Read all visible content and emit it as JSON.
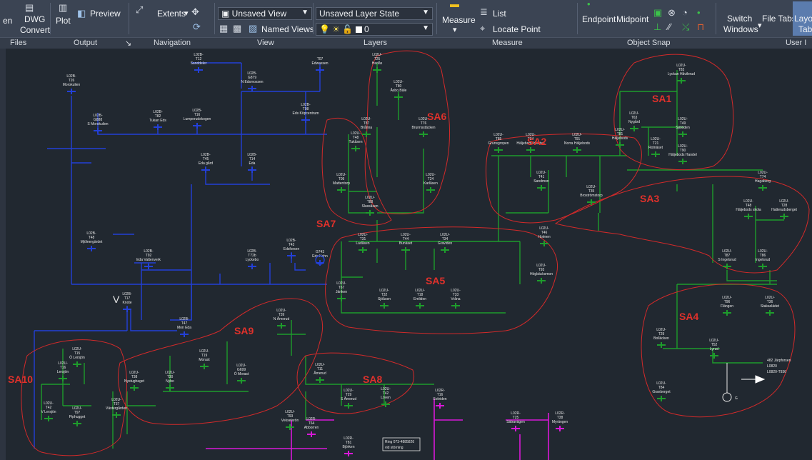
{
  "ribbon": {
    "buttons": {
      "open": "en",
      "dwg_convert_1": "DWG",
      "dwg_convert_2": "Convert",
      "plot": "Plot",
      "preview": "Preview",
      "extents": "Extents",
      "unsaved_view": "Unsaved View",
      "named_views": "Named Views",
      "layer_state": "Unsaved Layer State",
      "layer_current": "0",
      "measure": "Measure",
      "list": "List",
      "locate_point": "Locate Point",
      "endpoint": "Endpoint",
      "midpoint": "Midpoint",
      "switch_windows_1": "Switch",
      "switch_windows_2": "Windows",
      "file_tabs": "File Tabs",
      "layout_tabs_1": "Layo",
      "layout_tabs_2": "Tabs"
    },
    "groups": {
      "files": "Files",
      "output": "Output",
      "navigation": "Navigation",
      "view": "View",
      "layers": "Layers",
      "measure": "Measure",
      "object_snap": "Object Snap",
      "user_interface": "User I"
    }
  },
  "drawing": {
    "areas": [
      {
        "id": "SA1",
        "label": "SA1"
      },
      {
        "id": "SA2",
        "label": "SA2"
      },
      {
        "id": "SA3",
        "label": "SA3"
      },
      {
        "id": "SA4",
        "label": "SA4"
      },
      {
        "id": "SA5",
        "label": "SA5"
      },
      {
        "id": "SA6",
        "label": "SA6"
      },
      {
        "id": "SA7",
        "label": "SA7"
      },
      {
        "id": "SA8",
        "label": "SA8"
      },
      {
        "id": "SA9",
        "label": "SA9"
      },
      {
        "id": "SA10",
        "label": "SA10"
      }
    ],
    "nodes": [
      {
        "id": "n1",
        "l1": "L02B-",
        "l2": "T26",
        "l3": "Morokulien"
      },
      {
        "id": "n2",
        "l1": "L02B-",
        "l2": "T12",
        "l3": "Sanddeler"
      },
      {
        "id": "n3",
        "l1": "",
        "l2": "T07",
        "l3": "Edwassen"
      },
      {
        "id": "n4",
        "l1": "L02B-",
        "l2": "G879",
        "l3": "N Edsmossen"
      },
      {
        "id": "n5",
        "l1": "L02B-",
        "l2": "G888",
        "l3": "S Morokulien"
      },
      {
        "id": "n6",
        "l1": "L02B-",
        "l2": "T82",
        "l3": "Tukan Eds"
      },
      {
        "id": "n7",
        "l1": "L02B-",
        "l2": "T16",
        "l3": "Lumperudskogen"
      },
      {
        "id": "n8",
        "l1": "L02B-",
        "l2": "T98",
        "l3": "Eds Köpcentrum"
      },
      {
        "id": "n9",
        "l1": "L02B-",
        "l2": "T45",
        "l3": "Eda gård"
      },
      {
        "id": "n10",
        "l1": "L02B-",
        "l2": "T14",
        "l3": "Eda"
      },
      {
        "id": "n11",
        "l1": "L02B-",
        "l2": "T48",
        "l3": "Mjölnergärdet"
      },
      {
        "id": "n12",
        "l1": "L02B-",
        "l2": "T92",
        "l3": "Eda Vattenverk"
      },
      {
        "id": "n13",
        "l1": "L02B-",
        "l2": "T43",
        "l3": "Edsforsen"
      },
      {
        "id": "n14",
        "l1": "",
        "l2": "G743",
        "l3": "Eds Kehn"
      },
      {
        "id": "n15",
        "l1": "L02B-",
        "l2": "T72b",
        "l3": "Lyckebo"
      },
      {
        "id": "n16",
        "l1": "L02B-",
        "l2": "T17",
        "l3": "Knote"
      },
      {
        "id": "n17",
        "l1": "L02B-",
        "l2": "T47",
        "l3": "Mon Eda"
      },
      {
        "id": "n18",
        "l1": "L02U-",
        "l2": "T25",
        "l3": "Hedås"
      },
      {
        "id": "n19",
        "l1": "L02U-",
        "l2": "T80",
        "l3": "Åsbo Bäle"
      },
      {
        "id": "n20",
        "l1": "L02U-",
        "l2": "T87",
        "l3": "Brånna"
      },
      {
        "id": "n21",
        "l1": "L02U-",
        "l2": "T76",
        "l3": "Brunnsstäcken"
      },
      {
        "id": "n22",
        "l1": "L02U-",
        "l2": "T48",
        "l3": "Tukåsen"
      },
      {
        "id": "n23",
        "l1": "L02U-",
        "l2": "T09",
        "l3": "Mattentorp"
      },
      {
        "id": "n24",
        "l1": "L02U-",
        "l2": "T24",
        "l3": "Karlåsen"
      },
      {
        "id": "n25",
        "l1": "L02U-",
        "l2": "T88",
        "l3": "Slussåsen"
      },
      {
        "id": "n26",
        "l1": "L02U-",
        "l2": "T85",
        "l3": "Grunsgropen"
      },
      {
        "id": "n27",
        "l1": "L02U-",
        "l2": "T84",
        "l3": "Häljebods Klätten"
      },
      {
        "id": "n28",
        "l1": "L02U-",
        "l2": "T91",
        "l3": "Norra Häljebods"
      },
      {
        "id": "n29",
        "l1": "L02U-",
        "l2": "T81",
        "l3": "Häljebods"
      },
      {
        "id": "n30",
        "l1": "L02U-",
        "l2": "T83",
        "l3": "Lyckan Håvilerud"
      },
      {
        "id": "n31",
        "l1": "L02U-",
        "l2": "T63",
        "l3": "Nygård"
      },
      {
        "id": "n32",
        "l1": "L02U-",
        "l2": "T21",
        "l3": "Rotnäset"
      },
      {
        "id": "n33",
        "l1": "L02U-",
        "l2": "T49",
        "l3": "Sjölöden"
      },
      {
        "id": "n34",
        "l1": "L02U-",
        "l2": "T90",
        "l3": "Häljebods Handel"
      },
      {
        "id": "n35",
        "l1": "L02U-",
        "l2": "T41",
        "l3": "Sandmon"
      },
      {
        "id": "n36",
        "l1": "L02U-",
        "l2": "T35",
        "l3": "Broströmstorp"
      },
      {
        "id": "n37",
        "l1": "L02U-",
        "l2": "T46",
        "l3": "Holmen"
      },
      {
        "id": "n38",
        "l1": "L02U-",
        "l2": "T74",
        "l3": "Hagaberg"
      },
      {
        "id": "n39",
        "l1": "L02U-",
        "l2": "T48",
        "l3": "Häljebods skola"
      },
      {
        "id": "n40",
        "l1": "L02U-",
        "l2": "T28",
        "l3": "Hatterudsberget"
      },
      {
        "id": "n41",
        "l1": "L02U-",
        "l2": "T31",
        "l3": "Ladåsen"
      },
      {
        "id": "n42",
        "l1": "L02U-",
        "l2": "T44",
        "l3": "Bunäset"
      },
      {
        "id": "n43",
        "l1": "L02U-",
        "l2": "T34",
        "l3": "Graviden"
      },
      {
        "id": "n44",
        "l1": "L02U-",
        "l2": "T93",
        "l3": "Högbäcksmon"
      },
      {
        "id": "n45",
        "l1": "L02U-",
        "l2": "T67",
        "l3": "Jänken"
      },
      {
        "id": "n46",
        "l1": "L02U-",
        "l2": "T32",
        "l3": "Sjöåsen"
      },
      {
        "id": "n47",
        "l1": "L02U-",
        "l2": "T18",
        "l3": "Emliden"
      },
      {
        "id": "n48",
        "l1": "L02U-",
        "l2": "T33",
        "l3": "Vråna"
      },
      {
        "id": "n49",
        "l1": "L02U-",
        "l2": "T87",
        "l3": "S Ingelsrud"
      },
      {
        "id": "n50",
        "l1": "L02U-",
        "l2": "T86",
        "l3": "Ingelsrud"
      },
      {
        "id": "n51",
        "l1": "L02U-",
        "l2": "T96",
        "l3": "Flängen"
      },
      {
        "id": "n52",
        "l1": "L02U-",
        "l2": "T36",
        "l3": "Stakaslädet"
      },
      {
        "id": "n53",
        "l1": "L02U-",
        "l2": "T29",
        "l3": "Bolläcken"
      },
      {
        "id": "n54",
        "l1": "L02U-",
        "l2": "T52",
        "l3": "Lyrud"
      },
      {
        "id": "n55",
        "l1": "L02U-",
        "l2": "T84",
        "l3": "Granberget"
      },
      {
        "id": "n56",
        "l1": "L02U-",
        "l2": "T39",
        "l3": "N Åmerud"
      },
      {
        "id": "n57",
        "l1": "L02U-",
        "l2": "T11",
        "l3": "Åmerud"
      },
      {
        "id": "n58",
        "l1": "L02U-",
        "l2": "T29",
        "l3": "S Åmerud"
      },
      {
        "id": "n59",
        "l1": "L02U-",
        "l2": "T42",
        "l3": "Löven"
      },
      {
        "id": "n60",
        "l1": "L02U-",
        "l2": "T19",
        "l3": "Morast"
      },
      {
        "id": "n61",
        "l1": "L02U-",
        "l2": "G699",
        "l3": "Ö Morast"
      },
      {
        "id": "n62",
        "l1": "L02U-",
        "l2": "T38",
        "l3": "Nystughaget"
      },
      {
        "id": "n63",
        "l1": "L02U-",
        "l2": "T30",
        "l3": "Nybo"
      },
      {
        "id": "n64",
        "l1": "L02U-",
        "l2": "T93",
        "l3": "Vekselsrön"
      },
      {
        "id": "n65",
        "l1": "L02U-",
        "l2": "T37",
        "l3": "Västergården"
      },
      {
        "id": "n66",
        "l1": "L02U-",
        "l2": "T15",
        "l3": "Ö Lersjön"
      },
      {
        "id": "n67",
        "l1": "L02U-",
        "l2": "T16",
        "l3": "Lersjön"
      },
      {
        "id": "n68",
        "l1": "L02U-",
        "l2": "T42",
        "l3": "V Lersjön"
      },
      {
        "id": "n69",
        "l1": "L02U-",
        "l2": "T97",
        "l3": "Piphugget"
      },
      {
        "id": "n70",
        "l1": "L02R-",
        "l2": "T16",
        "l3": "Solviden"
      },
      {
        "id": "n71",
        "l1": "L02R-",
        "l2": "T25",
        "l3": "Sätravägen"
      },
      {
        "id": "n72",
        "l1": "L02R-",
        "l2": "T38",
        "l3": "Myrängen"
      },
      {
        "id": "n73",
        "l1": "L02R-",
        "l2": "T81",
        "l3": "Björken"
      },
      {
        "id": "n74",
        "l1": "L02R-",
        "l2": "T64",
        "l3": "Abborren"
      }
    ],
    "annotations": {
      "ring_1": "Ring 073-4885826",
      "ring_2": "vid störning",
      "ext_1": "482 Järpforsen",
      "ext_2": "L0820",
      "ext_3": "L0820-T936",
      "gen": "G",
      "cursor": "V"
    }
  },
  "colors": {
    "ribbon_bg": "#3b4453",
    "canvas_bg": "#212830",
    "blue_line": "#2340d8",
    "green_line": "#1e9c2c",
    "magenta_line": "#d818d8",
    "region_red": "#d22a2a",
    "label_red": "#e0312b"
  }
}
